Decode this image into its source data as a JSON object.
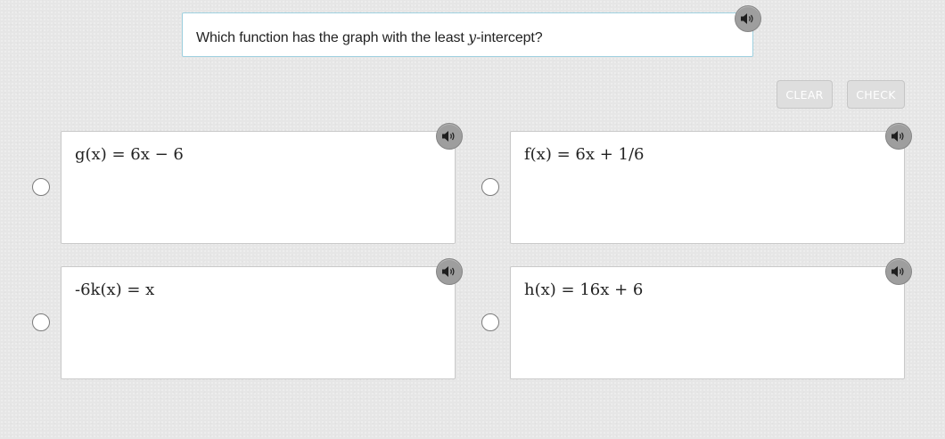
{
  "question": {
    "prefix": "Which function has the graph with the least ",
    "variable": "y",
    "suffix": "-intercept?"
  },
  "buttons": {
    "clear": "CLEAR",
    "check": "CHECK"
  },
  "answers": [
    {
      "label": "g(x) = 6x − 6",
      "selected": false
    },
    {
      "label": "f(x) = 6x + 1/6",
      "selected": false
    },
    {
      "label": "-6k(x) = x",
      "selected": false
    },
    {
      "label": "h(x) = 16x + 6",
      "selected": false
    }
  ],
  "icons": {
    "audio": "speaker-icon"
  },
  "colors": {
    "background": "#e6e6e6",
    "question_border": "#9ed0df",
    "audio_button": "#9e9e9e",
    "disabled_button": "#dedede"
  }
}
